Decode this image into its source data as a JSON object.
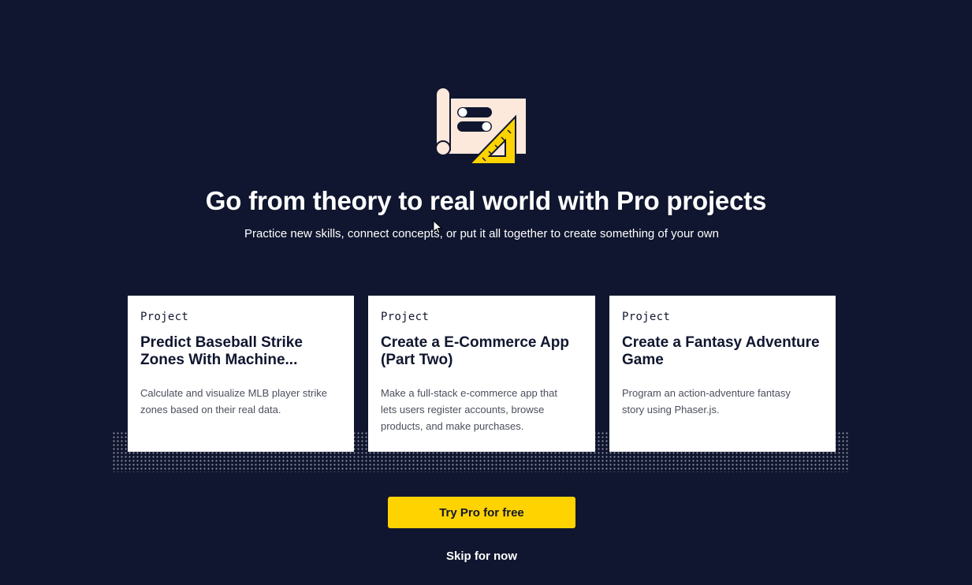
{
  "hero": {
    "illustration_icon": "blueprint-ruler-illustration",
    "headline": "Go from theory to real world with Pro projects",
    "subheadline": "Practice new skills, connect concepts, or put it all together to create something of your own"
  },
  "cards": [
    {
      "type": "Project",
      "title_line1": "Predict Baseball Strike",
      "title_line2": "Zones With Machine...",
      "description_line1": "Calculate and visualize MLB player strike",
      "description_line2": "zones based on their real data.",
      "description_line3": ""
    },
    {
      "type": "Project",
      "title_line1": "Create a E-Commerce App",
      "title_line2": "(Part Two)",
      "description_line1": "Make a full-stack e-commerce app that",
      "description_line2": "lets users register accounts, browse",
      "description_line3": "products, and make purchases."
    },
    {
      "type": "Project",
      "title_line1": "Create a Fantasy Adventure",
      "title_line2": "Game",
      "description_line1": "Program an action-adventure fantasy",
      "description_line2": "story using Phaser.js.",
      "description_line3": ""
    }
  ],
  "actions": {
    "primary_label": "Try Pro for free",
    "secondary_label": "Skip for now"
  },
  "colors": {
    "background": "#10162f",
    "accent": "#ffd300",
    "card": "#ffffff",
    "illustration_paper": "#fde8dc"
  }
}
